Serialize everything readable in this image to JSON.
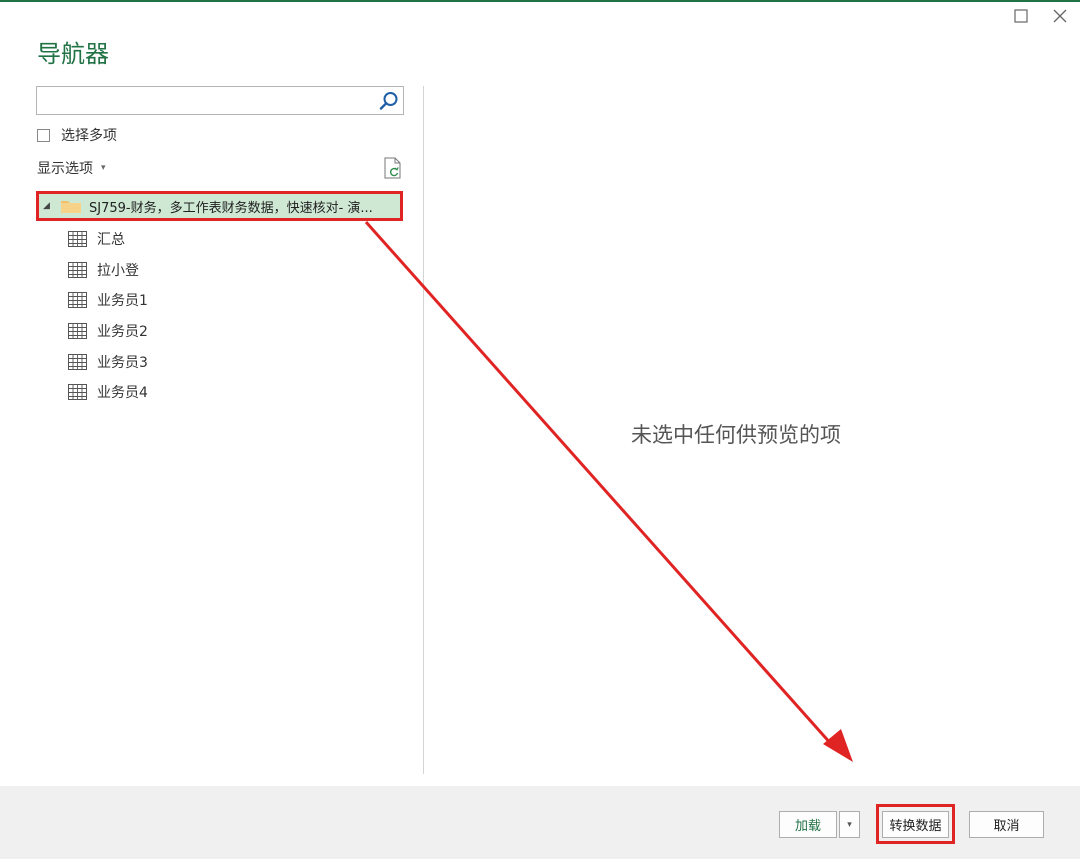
{
  "window": {
    "maximize_icon": "square-outline-icon",
    "close_icon": "x-close-icon",
    "title": "导航器"
  },
  "search": {
    "value": "",
    "placeholder": "",
    "icon": "search-icon"
  },
  "select_multiple": {
    "label": "选择多项",
    "checked": false
  },
  "display_options": {
    "label": "显示选项",
    "caret": "▾"
  },
  "refresh_icon": "refresh-file-icon",
  "tree": {
    "root": {
      "expander": "◢",
      "icon": "folder-icon",
      "label": "SJ759-财务，多工作表财务数据，快速核对- 演..."
    },
    "sheets": [
      {
        "label": "汇总",
        "icon": "table-icon"
      },
      {
        "label": "拉小登",
        "icon": "table-icon"
      },
      {
        "label": "业务员1",
        "icon": "table-icon"
      },
      {
        "label": "业务员2",
        "icon": "table-icon"
      },
      {
        "label": "业务员3",
        "icon": "table-icon"
      },
      {
        "label": "业务员4",
        "icon": "table-icon"
      }
    ]
  },
  "preview": {
    "empty_message": "未选中任何供预览的项"
  },
  "footer": {
    "load_label": "加载",
    "load_dropdown": "▾",
    "transform_label": "转换数据",
    "cancel_label": "取消"
  },
  "colors": {
    "accent": "#217346",
    "highlight": "#e02424",
    "selection": "#cfe8d4"
  }
}
